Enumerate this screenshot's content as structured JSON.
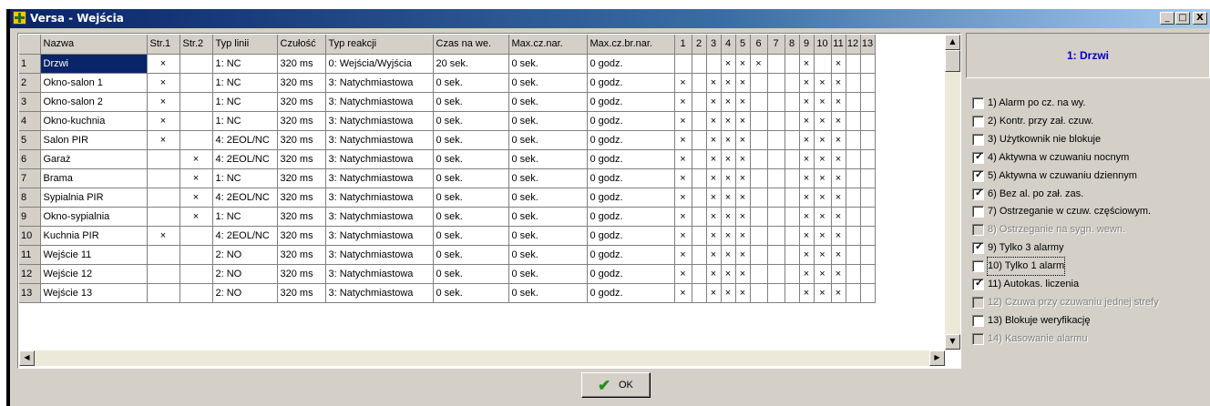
{
  "window": {
    "title": "Versa - Wejścia",
    "minimize": "_",
    "restore": "□",
    "close": "X"
  },
  "grid": {
    "columns": [
      "",
      "Nazwa",
      "Str.1",
      "Str.2",
      "Typ linii",
      "Czułość",
      "Typ reakcji",
      "Czas na we.",
      "Max.cz.nar.",
      "Max.cz.br.nar.",
      "1",
      "2",
      "3",
      "4",
      "5",
      "6",
      "7",
      "8",
      "9",
      "10",
      "11",
      "12",
      "13"
    ],
    "rows": [
      [
        "1",
        "Drzwi",
        "×",
        "",
        "1: NC",
        "320 ms",
        "0: Wejścia/Wyjścia",
        "20 sek.",
        "0 sek.",
        "0 godz.",
        "",
        "",
        "",
        "×",
        "×",
        "×",
        "",
        "",
        "×",
        "",
        "×",
        "",
        ""
      ],
      [
        "2",
        "Okno-salon 1",
        "×",
        "",
        "1: NC",
        "320 ms",
        "3: Natychmiastowa",
        "0 sek.",
        "0 sek.",
        "0 godz.",
        "×",
        "",
        "×",
        "×",
        "×",
        "",
        "",
        "",
        "×",
        "×",
        "×",
        "",
        ""
      ],
      [
        "3",
        "Okno-salon 2",
        "×",
        "",
        "1: NC",
        "320 ms",
        "3: Natychmiastowa",
        "0 sek.",
        "0 sek.",
        "0 godz.",
        "×",
        "",
        "×",
        "×",
        "×",
        "",
        "",
        "",
        "×",
        "×",
        "×",
        "",
        ""
      ],
      [
        "4",
        "Okno-kuchnia",
        "×",
        "",
        "1: NC",
        "320 ms",
        "3: Natychmiastowa",
        "0 sek.",
        "0 sek.",
        "0 godz.",
        "×",
        "",
        "×",
        "×",
        "×",
        "",
        "",
        "",
        "×",
        "×",
        "×",
        "",
        ""
      ],
      [
        "5",
        "Salon PIR",
        "×",
        "",
        "4: 2EOL/NC",
        "320 ms",
        "3: Natychmiastowa",
        "0 sek.",
        "0 sek.",
        "0 godz.",
        "×",
        "",
        "×",
        "×",
        "×",
        "",
        "",
        "",
        "×",
        "×",
        "×",
        "",
        ""
      ],
      [
        "6",
        "Garaż",
        "",
        "×",
        "4: 2EOL/NC",
        "320 ms",
        "3: Natychmiastowa",
        "0 sek.",
        "0 sek.",
        "0 godz.",
        "×",
        "",
        "×",
        "×",
        "×",
        "",
        "",
        "",
        "×",
        "×",
        "×",
        "",
        ""
      ],
      [
        "7",
        "Brama",
        "",
        "×",
        "1: NC",
        "320 ms",
        "3: Natychmiastowa",
        "0 sek.",
        "0 sek.",
        "0 godz.",
        "×",
        "",
        "×",
        "×",
        "×",
        "",
        "",
        "",
        "×",
        "×",
        "×",
        "",
        ""
      ],
      [
        "8",
        "Sypialnia PIR",
        "",
        "×",
        "4: 2EOL/NC",
        "320 ms",
        "3: Natychmiastowa",
        "0 sek.",
        "0 sek.",
        "0 godz.",
        "×",
        "",
        "×",
        "×",
        "×",
        "",
        "",
        "",
        "×",
        "×",
        "×",
        "",
        ""
      ],
      [
        "9",
        "Okno-sypialnia",
        "",
        "×",
        "1: NC",
        "320 ms",
        "3: Natychmiastowa",
        "0 sek.",
        "0 sek.",
        "0 godz.",
        "×",
        "",
        "×",
        "×",
        "×",
        "",
        "",
        "",
        "×",
        "×",
        "×",
        "",
        ""
      ],
      [
        "10",
        "Kuchnia PIR",
        "×",
        "",
        "4: 2EOL/NC",
        "320 ms",
        "3: Natychmiastowa",
        "0 sek.",
        "0 sek.",
        "0 godz.",
        "×",
        "",
        "×",
        "×",
        "×",
        "",
        "",
        "",
        "×",
        "×",
        "×",
        "",
        ""
      ],
      [
        "11",
        "Wejście 11",
        "",
        "",
        "2: NO",
        "320 ms",
        "3: Natychmiastowa",
        "0 sek.",
        "0 sek.",
        "0 godz.",
        "×",
        "",
        "×",
        "×",
        "×",
        "",
        "",
        "",
        "×",
        "×",
        "×",
        "",
        ""
      ],
      [
        "12",
        "Wejście 12",
        "",
        "",
        "2: NO",
        "320 ms",
        "3: Natychmiastowa",
        "0 sek.",
        "0 sek.",
        "0 godz.",
        "×",
        "",
        "×",
        "×",
        "×",
        "",
        "",
        "",
        "×",
        "×",
        "×",
        "",
        ""
      ],
      [
        "13",
        "Wejście 13",
        "",
        "",
        "2: NO",
        "320 ms",
        "3: Natychmiastowa",
        "0 sek.",
        "0 sek.",
        "0 godz.",
        "×",
        "",
        "×",
        "×",
        "×",
        "",
        "",
        "",
        "×",
        "×",
        "×",
        "",
        ""
      ]
    ],
    "selected_cell": "Drzwi"
  },
  "zone_panel": {
    "title": "1: Drzwi",
    "options": [
      {
        "label": "1) Alarm po cz. na wy.",
        "checked": false,
        "enabled": true
      },
      {
        "label": "2) Kontr. przy zał. czuw.",
        "checked": false,
        "enabled": true
      },
      {
        "label": "3) Użytkownik nie blokuje",
        "checked": false,
        "enabled": true
      },
      {
        "label": "4) Aktywna w czuwaniu nocnym",
        "checked": true,
        "enabled": true
      },
      {
        "label": "5) Aktywna w czuwaniu dziennym",
        "checked": true,
        "enabled": true
      },
      {
        "label": "6) Bez al. po zał. zas.",
        "checked": true,
        "enabled": true
      },
      {
        "label": "7) Ostrzeganie w czuw. częściowym.",
        "checked": false,
        "enabled": true
      },
      {
        "label": "8) Ostrzeganie na sygn. wewn.",
        "checked": false,
        "enabled": false
      },
      {
        "label": "9) Tylko 3 alarmy",
        "checked": true,
        "enabled": true
      },
      {
        "label": "10) Tylko 1 alarm",
        "checked": false,
        "enabled": true,
        "focused": true
      },
      {
        "label": "11) Autokas. liczenia",
        "checked": true,
        "enabled": true
      },
      {
        "label": "12) Czuwa przy czuwaniu jednej strefy",
        "checked": false,
        "enabled": false
      },
      {
        "label": "13) Blokuje weryfikację",
        "checked": false,
        "enabled": true
      },
      {
        "label": "14) Kasowanie alarmu",
        "checked": false,
        "enabled": false
      }
    ]
  },
  "buttons": {
    "ok": "OK"
  },
  "icons": {
    "ok": "check-icon",
    "app": "versa-app-icon"
  },
  "colors": {
    "selection": "#0a246a",
    "zone_title": "#0000c0",
    "ok_check": "#1f8f1f"
  }
}
